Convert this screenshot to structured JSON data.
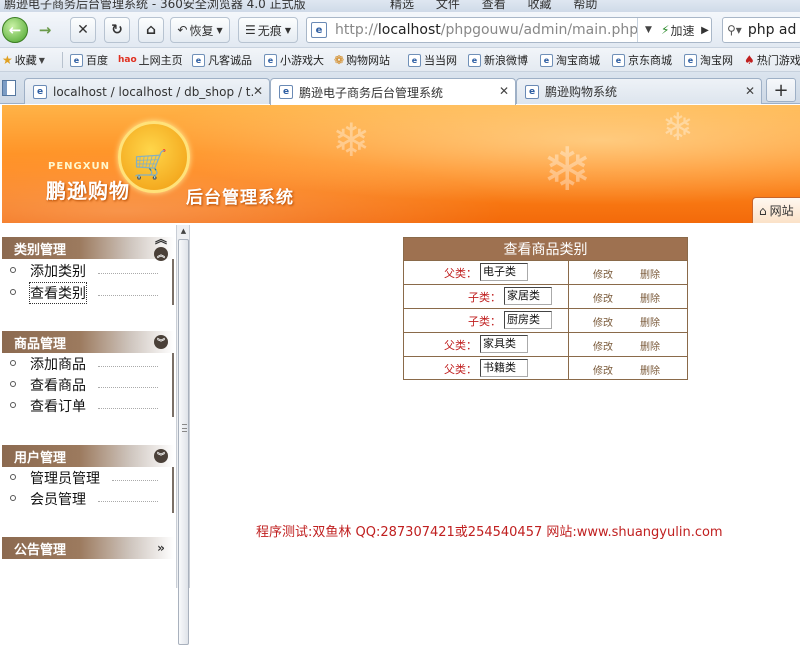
{
  "window": {
    "title": "鹏逊电子商务后台管理系统 - 360安全浏览器 4.0 正式版",
    "menus": [
      "精选",
      "文件",
      "查看",
      "收藏",
      "帮助"
    ]
  },
  "nav": {
    "back_label": "←",
    "forward_label": "→",
    "restore_label": "恢复",
    "trace_label": "无痕",
    "url_prefix": "http://",
    "url_host": "localhost",
    "url_path": "/phpgouwu/admin/main.php",
    "accelerate_label": "加速",
    "search_value": "php ad"
  },
  "favorites": {
    "collect_label": "收藏",
    "items": [
      "百度",
      "上网主页",
      "凡客诚品",
      "小游戏大",
      "购物网站",
      "当当网",
      "新浪微博",
      "淘宝商城",
      "京东商城",
      "淘宝网",
      "热门游戏"
    ]
  },
  "tabs": [
    {
      "label": "localhost / localhost / db_shop / t...",
      "active": false
    },
    {
      "label": "鹏逊电子商务后台管理系统",
      "active": true
    },
    {
      "label": "鹏逊购物系统",
      "active": false
    }
  ],
  "banner": {
    "brand_en": "PENGXUN",
    "brand": "鹏逊购物",
    "system": "后台管理系统",
    "site_button": "网站"
  },
  "sidebar": {
    "sections": [
      {
        "title": "类别管理",
        "items": [
          "添加类别",
          "查看类别"
        ]
      },
      {
        "title": "商品管理",
        "items": [
          "添加商品",
          "查看商品",
          "查看订单"
        ]
      },
      {
        "title": "用户管理",
        "items": [
          "管理员管理",
          "会员管理"
        ]
      },
      {
        "title": "公告管理",
        "items": []
      }
    ]
  },
  "category_table": {
    "title": "查看商品类别",
    "parent_label": "父类：",
    "child_label": "子类：",
    "edit_label": "修改",
    "delete_label": "删除",
    "rows": [
      {
        "kind": "parent",
        "name": "电子类"
      },
      {
        "kind": "child",
        "name": "家居类"
      },
      {
        "kind": "child",
        "name": "厨房类"
      },
      {
        "kind": "parent",
        "name": "家具类"
      },
      {
        "kind": "parent",
        "name": "书籍类"
      }
    ]
  },
  "footer": "程序测试:双鱼林 QQ:287307421或254540457 网站:www.shuangyulin.com",
  "colors": {
    "banner_orange": "#ff8a1e",
    "table_header": "#9e7150",
    "menu_header": "#8c6a50",
    "footer_red": "#c02020"
  }
}
